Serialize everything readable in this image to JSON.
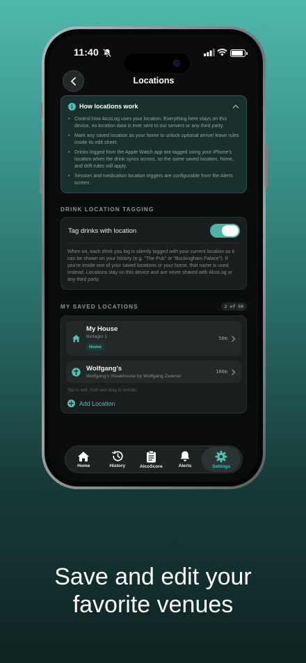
{
  "status_bar": {
    "time": "11:40"
  },
  "nav": {
    "title": "Locations"
  },
  "info": {
    "title": "How locations work",
    "items": [
      "Control how AlcoLog uses your location. Everything here stays on this device, no location data is ever sent to our servers or any third party.",
      "Mark any saved location as your home to unlock optional arrive/ leave rules inside its edit sheet.",
      "Drinks logged from the Apple Watch app are tagged using your iPhone's location when the drink syncs across, so the same saved location, home, and drift rules still apply.",
      "Session and medication location triggers are configurable from the Alerts screen."
    ]
  },
  "tagging": {
    "section_label": "DRINK LOCATION TAGGING",
    "toggle_label": "Tag drinks with location",
    "toggle_on": true,
    "description": "When on, each drink you log is silently tagged with your current location so it can be shown on your history (e.g. \"The Pub\" or \"Buckingham Palace\"). If you're inside one of your saved locations or your home, that name is used instead. Locations stay on this device and are never shared with AlcoLog or any third party."
  },
  "saved": {
    "section_label": "MY SAVED LOCATIONS",
    "count": "2 of 50",
    "items": [
      {
        "name": "My House",
        "sub": "Bellagio 1",
        "badge": "Home",
        "distance": "50m",
        "icon": "home-icon"
      },
      {
        "name": "Wolfgang's",
        "sub": "Wolfgang's Steakhouse by Wolfgang Zwiener",
        "distance": "100m",
        "icon": "pin-icon"
      }
    ],
    "hint": "Tap to edit. Hold and drag to reorder.",
    "add_label": "Add Location"
  },
  "tabs": [
    {
      "label": "Home",
      "icon": "house-icon"
    },
    {
      "label": "History",
      "icon": "history-icon"
    },
    {
      "label": "AlcoScore",
      "icon": "clipboard-icon"
    },
    {
      "label": "Alerts",
      "icon": "bell-icon"
    },
    {
      "label": "Settings",
      "icon": "gear-icon",
      "active": true
    }
  ],
  "caption": {
    "line1": "Save and edit your",
    "line2": "favorite venues"
  },
  "colors": {
    "accent": "#4fc0b2",
    "card": "#1a1e1e",
    "info_card": "#18302d"
  }
}
